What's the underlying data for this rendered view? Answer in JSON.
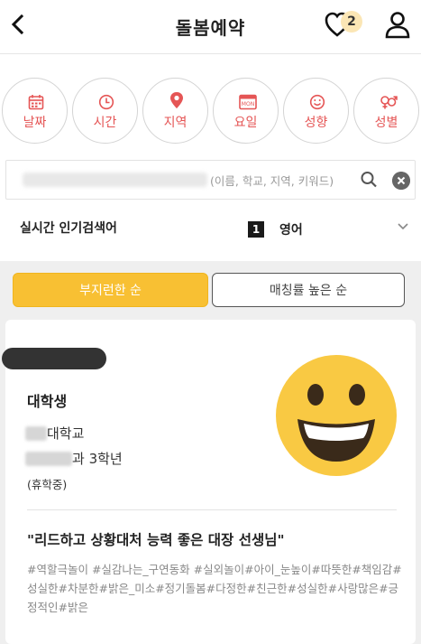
{
  "header": {
    "title": "돌봄예약",
    "heart_count": "2"
  },
  "filters": [
    {
      "label": "날짜",
      "icon": "calendar-icon"
    },
    {
      "label": "시간",
      "icon": "clock-icon"
    },
    {
      "label": "지역",
      "icon": "location-pin-icon"
    },
    {
      "label": "요일",
      "icon": "weekday-icon",
      "icon_text": "MON"
    },
    {
      "label": "성향",
      "icon": "smile-icon"
    },
    {
      "label": "성별",
      "icon": "gender-icon"
    }
  ],
  "search": {
    "placeholder": "(이름, 학교, 지역, 키워드)"
  },
  "trending": {
    "label": "실시간 인기검색어",
    "rank": "1",
    "keyword": "영어"
  },
  "sort": {
    "active": "부지런한 순",
    "inactive": "매칭률 높은 순"
  },
  "card": {
    "role": "대학생",
    "university_suffix": "대학교",
    "department_suffix": "과 3학년",
    "status": "(휴학중)",
    "quote": "\"리드하고 상황대처 능력 좋은 대장 선생님\"",
    "tags": "#역할극놀이 #실감나는_구연동화 #실외놀이#아이_눈높이#따뜻한#책임감#성실한#차분한#밝은_미소#정기돌봄#다정한#친근한#성실한#사랑많은#긍정적인#밝은"
  },
  "colors": {
    "accent_red": "#e55555",
    "accent_yellow": "#f8c033",
    "emoji_yellow": "#f9c943"
  }
}
